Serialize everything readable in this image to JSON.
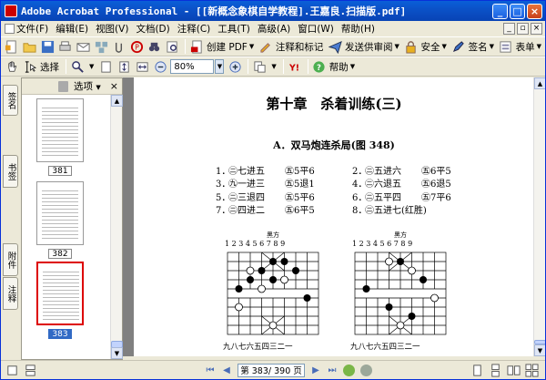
{
  "window": {
    "title": "Adobe Acrobat Professional - [[新概念象棋自学教程].王嘉良.扫描版.pdf]",
    "minimize": "_",
    "maximize": "□",
    "close": "×"
  },
  "menu": {
    "items": [
      "文件(F)",
      "编辑(E)",
      "视图(V)",
      "文档(D)",
      "注释(C)",
      "工具(T)",
      "高级(A)",
      "窗口(W)",
      "帮助(H)"
    ],
    "mdi_min": "_",
    "mdi_restore": "▫",
    "mdi_close": "×"
  },
  "toolbar1": {
    "create_pdf": "创建 PDF",
    "comment_markup": "注释和标记",
    "send_review": "发送供审阅",
    "secure": "安全",
    "sign": "签名",
    "forms": "表单"
  },
  "toolbar2": {
    "select": "选择",
    "zoom_value": "80%",
    "help": "帮助"
  },
  "nav_tabs": [
    "签名",
    "书签",
    "附件",
    "注释"
  ],
  "pages_panel": {
    "options_label": "选项",
    "close": "×",
    "thumbnails": [
      {
        "label": "381",
        "selected": false
      },
      {
        "label": "382",
        "selected": false
      },
      {
        "label": "383",
        "selected": true
      }
    ]
  },
  "document": {
    "chapter_title": "第十章　杀着训练(三)",
    "subtitle": "A．双马炮连杀局(图 348)",
    "moves": [
      {
        "n1": "1．",
        "r1": "㊁七进五",
        "b1": "㊄5平6",
        "n2": "2．",
        "r2": "㊁五进六",
        "b2": "㊄6平5"
      },
      {
        "n1": "3．",
        "r1": "㊈一进三",
        "b1": "㊄5退1",
        "n2": "4．",
        "r2": "㊁六退五",
        "b2": "㊄6退5"
      },
      {
        "n1": "5．",
        "r1": "㊁三退四",
        "b1": "㊄5平6",
        "n2": "6．",
        "r2": "㊁五平四",
        "b2": "㊄7平6"
      },
      {
        "n1": "7．",
        "r1": "㊁四进二",
        "b1": "㊄6平5",
        "n2": "8．",
        "r2": "㊁五进七(红胜)",
        "b2": ""
      }
    ],
    "board_left": {
      "side_label": "黑方",
      "top_numbers": "1 2 3 4 5 6 7 8 9",
      "bottom_numbers": "九八七六五四三二一"
    },
    "board_right": {
      "side_label": "黑方",
      "top_numbers": "1 2 3 4 5 6 7 8 9",
      "bottom_numbers": "九八七六五四三二一"
    }
  },
  "status": {
    "page_indicator": "第 383/ 390 页"
  },
  "colors": {
    "titlebar": "#0a5fd8",
    "selection": "#316ac5",
    "thumb_selected_border": "#dd0000"
  }
}
